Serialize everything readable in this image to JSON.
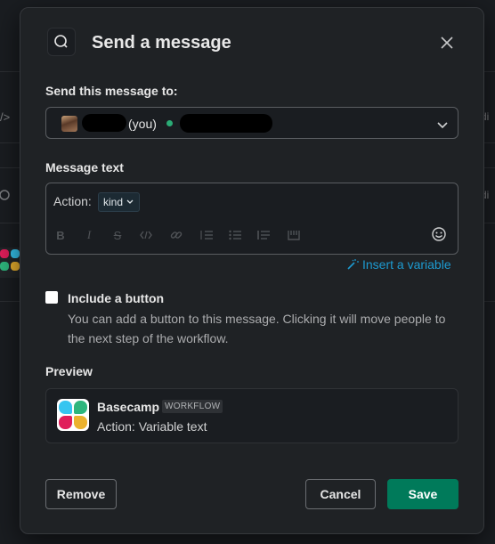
{
  "modal": {
    "title": "Send a message",
    "recipient_label": "Send this message to:",
    "recipient_you": "(you)",
    "message_label": "Message text",
    "message_prefix": "Action:",
    "variable_chip": "kind",
    "insert_variable": "Insert a variable",
    "include_button_label": "Include a button",
    "include_button_help": "You can add a button to this message. Clicking it will move people to the next step of the workflow.",
    "preview_label": "Preview",
    "preview": {
      "app_name": "Basecamp",
      "badge": "WORKFLOW",
      "text": "Action: Variable text"
    },
    "buttons": {
      "remove": "Remove",
      "cancel": "Cancel",
      "save": "Save"
    }
  },
  "background": {
    "left_glyph_1": "/>",
    "right_text": "Edi"
  },
  "colors": {
    "primary": "#007a5a",
    "link": "#1d9bd1",
    "presence": "#2bac76"
  },
  "icons": [
    "search-icon",
    "close-icon",
    "chevron-down-icon",
    "bold-icon",
    "italic-icon",
    "strikethrough-icon",
    "code-icon",
    "link-icon",
    "ordered-list-icon",
    "bullet-list-icon",
    "quote-icon",
    "code-block-icon",
    "emoji-icon",
    "magic-wand-icon"
  ]
}
